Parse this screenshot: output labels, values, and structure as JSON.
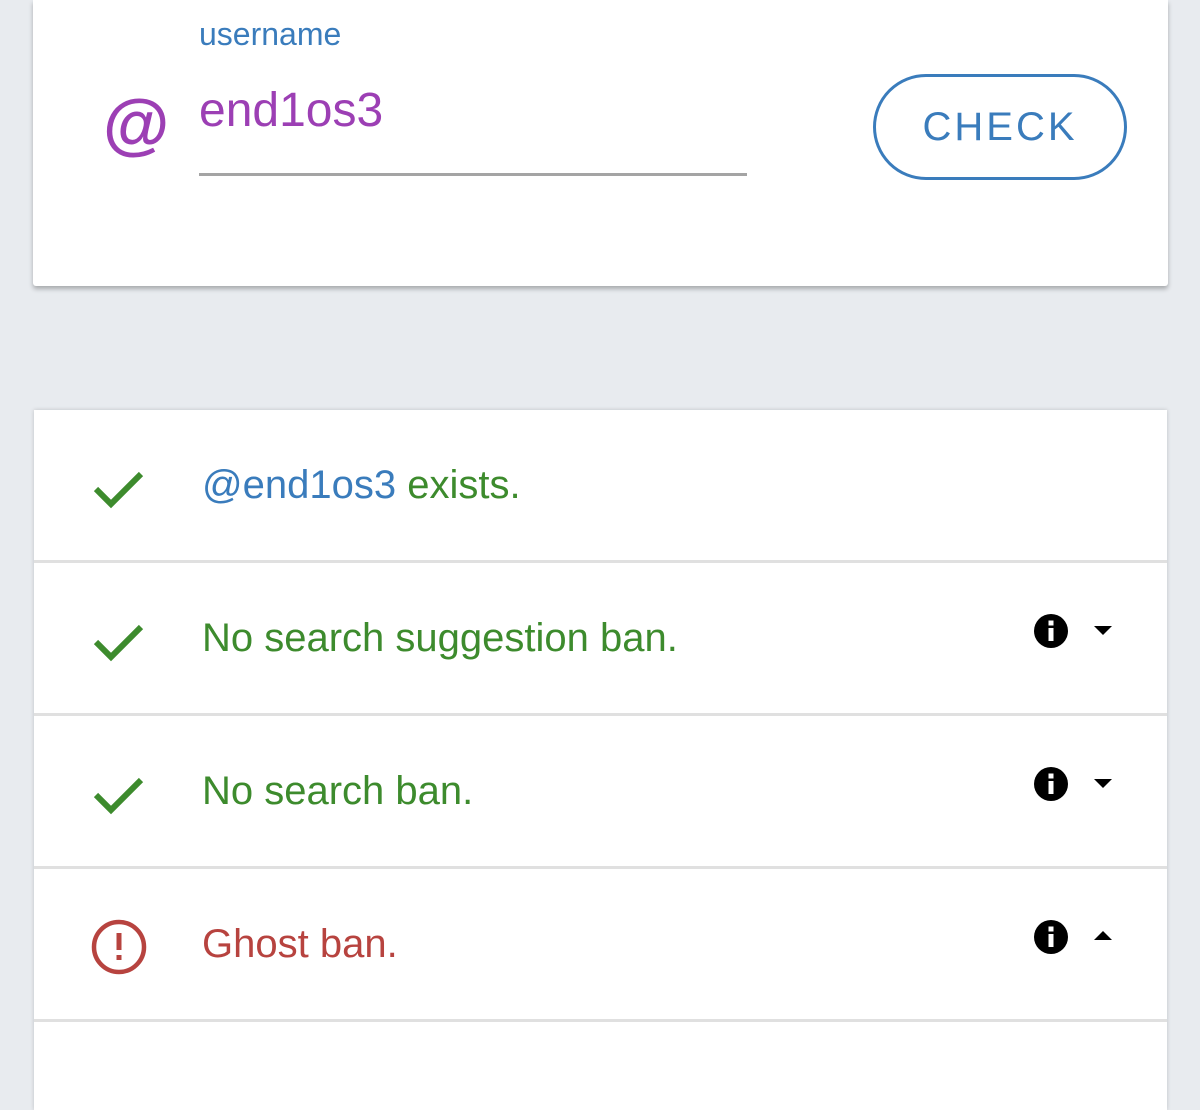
{
  "form": {
    "label": "username",
    "prefix_symbol": "@",
    "username_value": "end1os3",
    "check_label": "CHECK"
  },
  "results": [
    {
      "status": "ok",
      "icon": "check-icon",
      "handle": "@end1os3",
      "text": " exists.",
      "has_info": false
    },
    {
      "status": "ok",
      "icon": "check-icon",
      "text": "No search suggestion ban.",
      "has_info": true,
      "expanded": false
    },
    {
      "status": "ok",
      "icon": "check-icon",
      "text": "No search ban.",
      "has_info": true,
      "expanded": false
    },
    {
      "status": "banned",
      "icon": "alert-circle-icon",
      "text": "Ghost ban.",
      "has_info": true,
      "expanded": true
    }
  ],
  "colors": {
    "accent_blue": "#3a7cbc",
    "accent_purple": "#9c3fb4",
    "success_green": "#3d8b2d",
    "danger_red": "#b7433f",
    "background": "#e8ebef"
  }
}
